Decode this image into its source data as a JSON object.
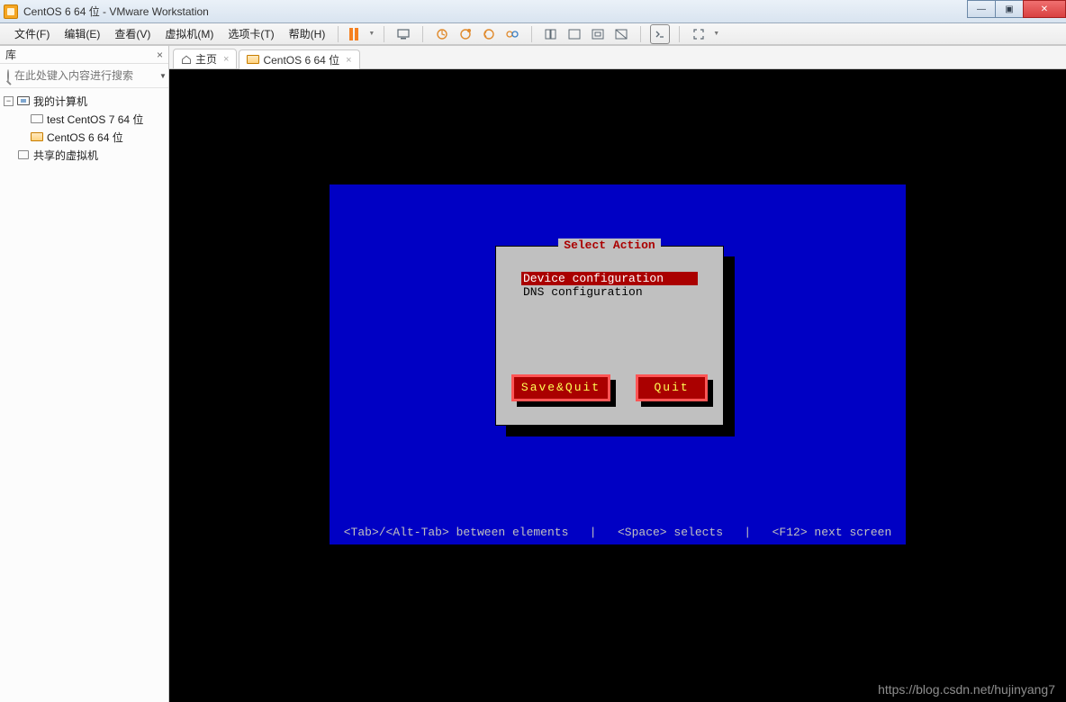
{
  "window": {
    "title": "CentOS 6 64 位 - VMware Workstation",
    "min": "—",
    "max": "▣",
    "close": "✕"
  },
  "menu": {
    "file": "文件(F)",
    "edit": "编辑(E)",
    "view": "查看(V)",
    "vm": "虚拟机(M)",
    "tabs": "选项卡(T)",
    "help": "帮助(H)"
  },
  "sidebar": {
    "header": "库",
    "close": "×",
    "search_placeholder": "在此处键入内容进行搜索",
    "root": "我的计算机",
    "items": [
      {
        "label": "test CentOS 7 64 位"
      },
      {
        "label": "CentOS 6 64 位"
      }
    ],
    "shared": "共享的虚拟机"
  },
  "tabs": {
    "home": "主页",
    "active": "CentOS 6 64 位"
  },
  "console": {
    "dialog_title": "Select Action",
    "options": [
      {
        "label": "Device configuration",
        "selected": true
      },
      {
        "label": "DNS configuration",
        "selected": false
      }
    ],
    "buttons": {
      "save": "Save&Quit",
      "quit": "Quit"
    },
    "hint": "<Tab>/<Alt-Tab> between elements   |   <Space> selects   |   <F12> next screen"
  },
  "watermark": "https://blog.csdn.net/hujinyang7"
}
